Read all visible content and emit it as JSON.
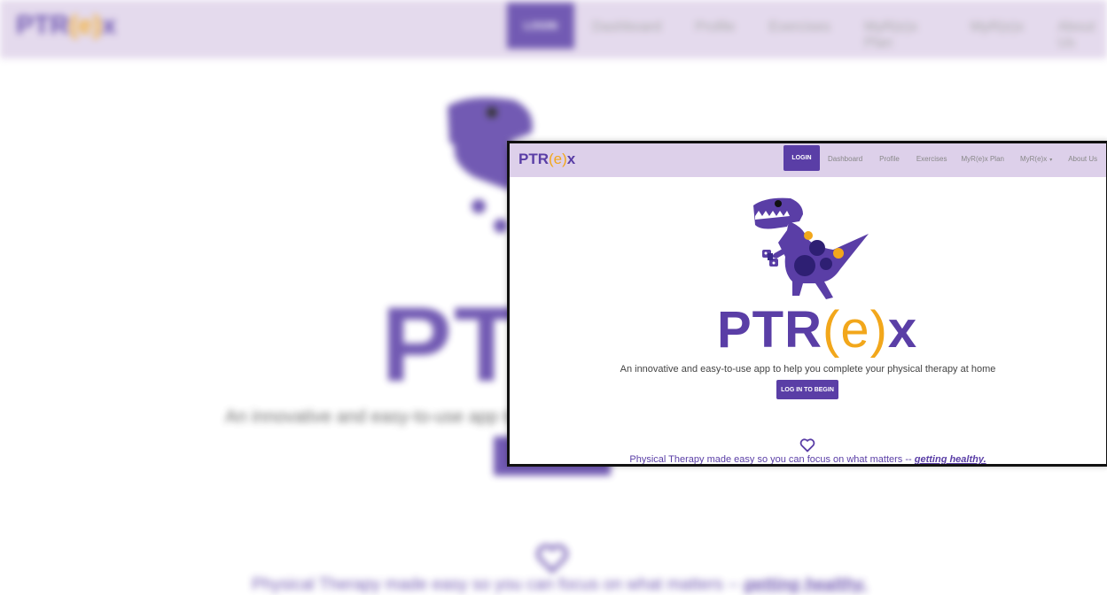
{
  "brand": {
    "pre": "PTR",
    "mid": "(e)",
    "post": "x"
  },
  "nav": {
    "login_label": "LOGIN",
    "links": [
      "Dashboard",
      "Profile",
      "Exercises",
      "MyR(e)x Plan",
      "MyR(e)x",
      "About Us"
    ],
    "dropdown_caret": "▾"
  },
  "hero": {
    "title_pre": "PTR",
    "title_mid": "(e)",
    "title_post": "x",
    "tagline": "An innovative and easy-to-use app to help you complete your physical therapy at home",
    "cta_label": "LOG IN TO BEGIN"
  },
  "footer": {
    "text": "Physical Therapy made easy so you can focus on what matters -- ",
    "emphasis": "getting healthy."
  },
  "colors": {
    "brand_purple": "#5a3ea6",
    "accent_orange": "#f2a71b",
    "nav_background": "#ddd0ea"
  },
  "icons": {
    "heart": "heart-icon",
    "mascot": "dinosaur-mascot"
  }
}
